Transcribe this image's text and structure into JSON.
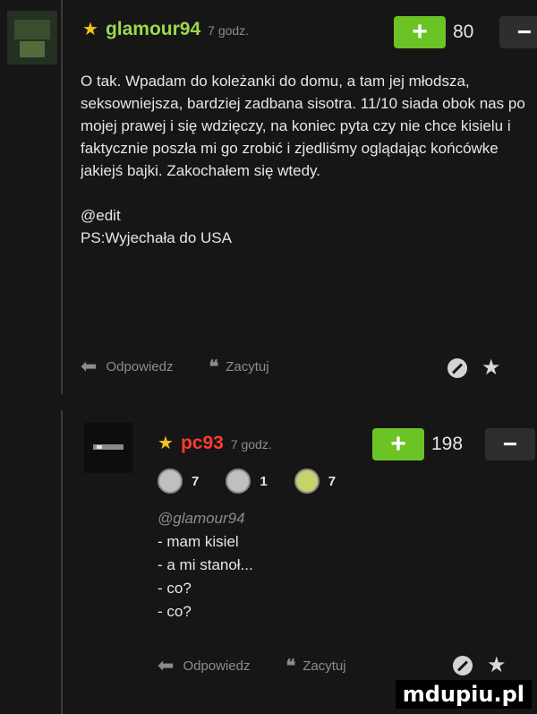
{
  "comment1": {
    "username": "glamour94",
    "time": "7 godz.",
    "score": "80",
    "plus_label": "+",
    "minus_label": "−",
    "paragraphs": [
      "O tak. Wpadam do koleżanki do domu, a tam jej młodsza, seksowniejsza, bardziej zadbana sisotra. 11/10 siada obok nas po mojej prawej i się wdzięczy, na koniec pyta czy nie chce kisielu i faktycznie poszła mi go zrobić i zjedliśmy oglądając końcówke jakiejś bajki. Zakochałem się wtedy.",
      "@edit",
      "PS:Wyjechała do USA"
    ],
    "reply_label": "Odpowiedz",
    "quote_label": "Zacytuj",
    "username_color": "#9bd94b"
  },
  "comment2": {
    "username": "pc93",
    "time": "7 godz.",
    "score": "198",
    "plus_label": "+",
    "minus_label": "−",
    "badges": [
      {
        "icon": "badge-icon",
        "count": "7"
      },
      {
        "icon": "badge-icon",
        "count": "1"
      },
      {
        "icon": "badge-icon",
        "count": "7"
      }
    ],
    "mention": "@glamour94",
    "lines": [
      "- mam kisiel",
      "- a mi stanoł...",
      "- co?",
      "- co?"
    ],
    "reply_label": "Odpowiedz",
    "quote_label": "Zacytuj",
    "username_color": "#ff3b2f"
  },
  "watermark": "mdupiu.pl"
}
